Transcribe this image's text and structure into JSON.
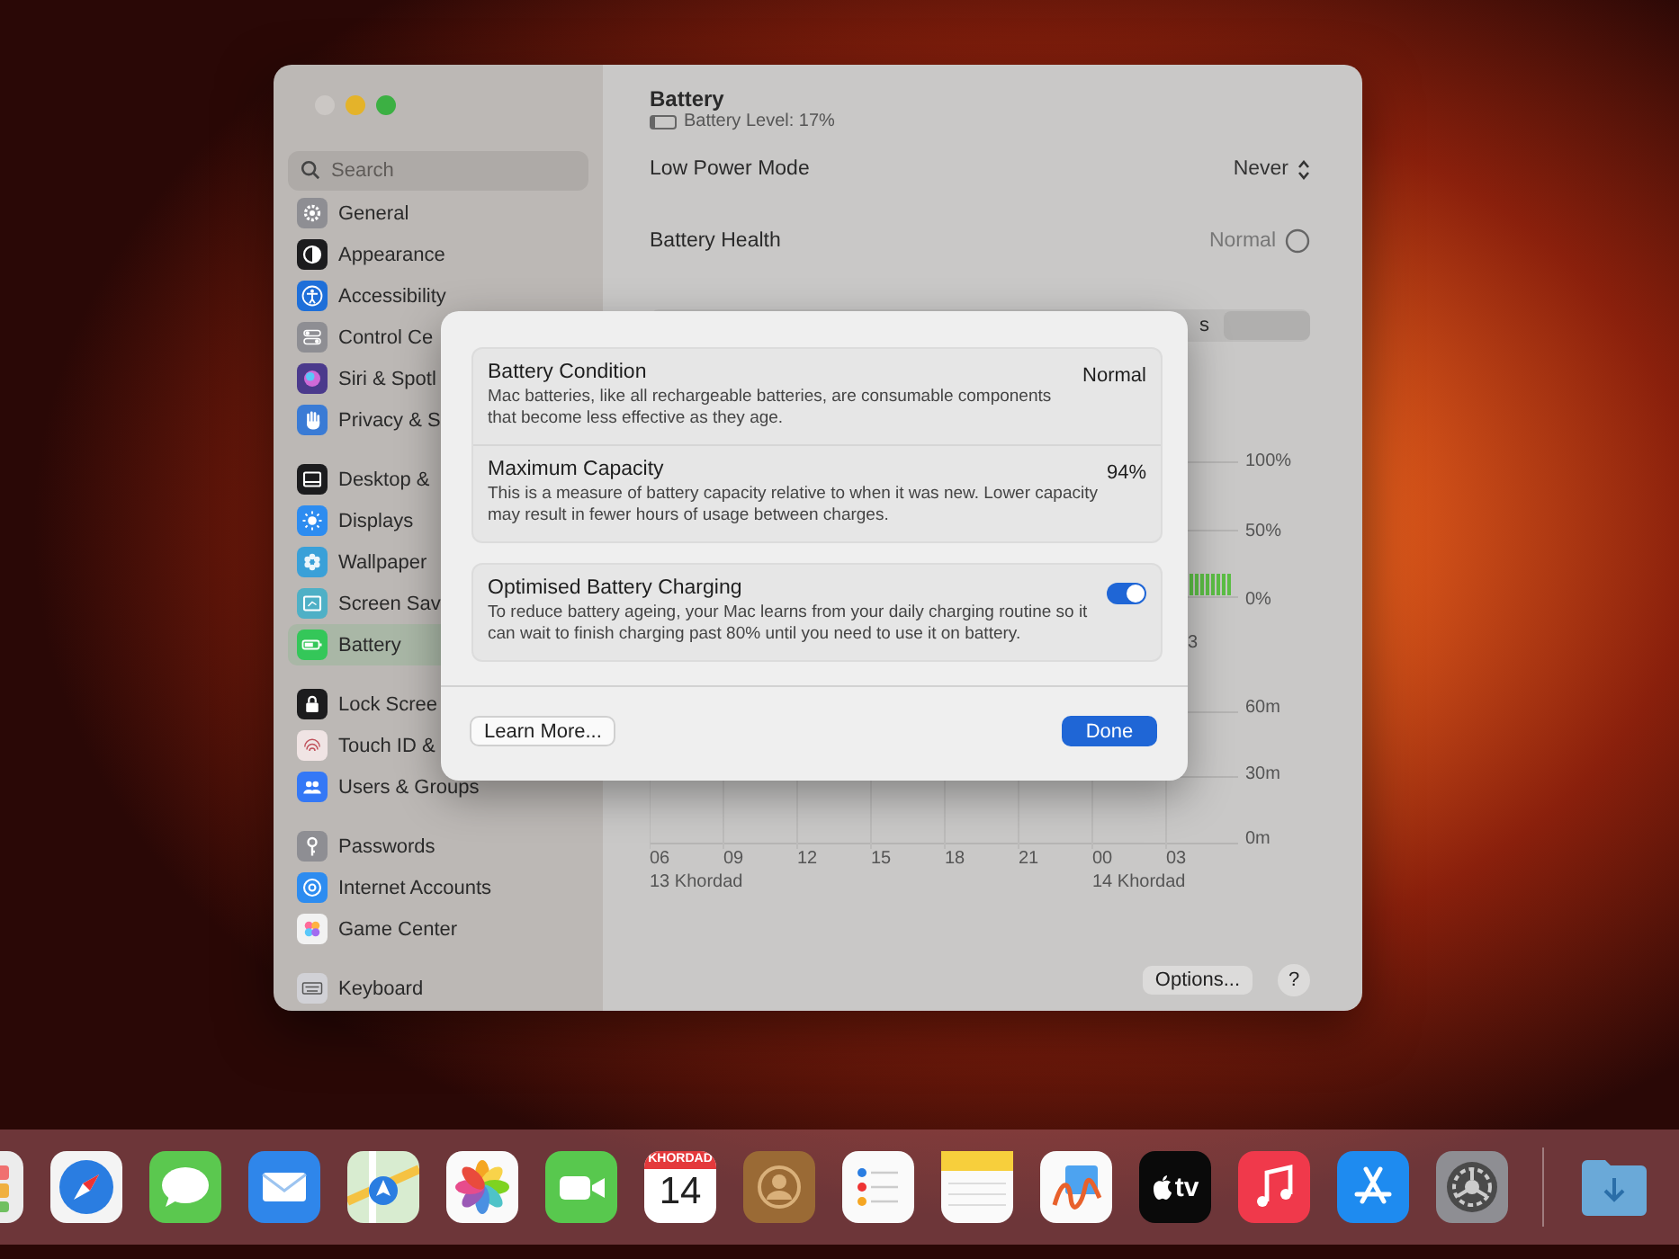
{
  "sidebar": {
    "search": {
      "placeholder": "Search"
    },
    "groups": [
      {
        "items": [
          {
            "label": "General",
            "color": "#8e8e93",
            "selected": false
          },
          {
            "label": "Appearance",
            "color": "#1c1c1e",
            "selected": false
          },
          {
            "label": "Accessibility",
            "color": "#1e6fd9",
            "selected": false
          },
          {
            "label": "Control Ce",
            "color": "#8e8e93",
            "selected": false
          },
          {
            "label": "Siri & Spotl",
            "color": "#4b3a8c",
            "selected": false
          },
          {
            "label": "Privacy & S",
            "color": "#3a7bd5",
            "selected": false
          }
        ]
      },
      {
        "items": [
          {
            "label": "Desktop &",
            "color": "#1c1c1e",
            "selected": false
          },
          {
            "label": "Displays",
            "color": "#2d8cf0",
            "selected": false
          },
          {
            "label": "Wallpaper",
            "color": "#3aa0d8",
            "selected": false
          },
          {
            "label": "Screen Sav",
            "color": "#4fb0c6",
            "selected": false
          },
          {
            "label": "Battery",
            "color": "#34c759",
            "selected": true
          }
        ]
      },
      {
        "items": [
          {
            "label": "Lock Scree",
            "color": "#1c1c1e",
            "selected": false
          },
          {
            "label": "Touch ID &",
            "color": "#f0e4e4",
            "selected": false
          },
          {
            "label": "Users & Groups",
            "color": "#3478f6",
            "selected": false
          }
        ]
      },
      {
        "items": [
          {
            "label": "Passwords",
            "color": "#8e8e93",
            "selected": false
          },
          {
            "label": "Internet Accounts",
            "color": "#2d8cf0",
            "selected": false
          },
          {
            "label": "Game Center",
            "color": "#f2f2f2",
            "selected": false
          }
        ]
      },
      {
        "items": [
          {
            "label": "Keyboard",
            "color": "#d1d1d6",
            "selected": false
          }
        ]
      }
    ]
  },
  "pane": {
    "title": "Battery",
    "battery_level": {
      "label": "Battery Level: 17%",
      "level": 0.17
    },
    "settings": [
      {
        "label": "Low Power Mode",
        "value": "Never",
        "kind": "popup"
      },
      {
        "label": "Battery Health",
        "value": "Normal",
        "kind": "info"
      }
    ],
    "segment_fragment": "s",
    "level_chart": {
      "yticks": [
        "100%",
        "50%",
        "0%"
      ],
      "hour_fragment": "3"
    },
    "usage_chart": {
      "yticks": [
        "60m",
        "30m",
        "0m"
      ],
      "hours": [
        {
          "label": "06",
          "date": "13 Khordad"
        },
        {
          "label": "09"
        },
        {
          "label": "12"
        },
        {
          "label": "15"
        },
        {
          "label": "18"
        },
        {
          "label": "21"
        },
        {
          "label": "00",
          "date": "14 Khordad"
        },
        {
          "label": "03"
        }
      ]
    },
    "options_button": "Options...",
    "help_button": "?"
  },
  "dialog": {
    "cards": [
      {
        "rows": [
          {
            "title": "Battery Condition",
            "description": "Mac batteries, like all rechargeable batteries, are consumable components that become less effective as they age.",
            "value": "Normal",
            "kind": "value"
          },
          {
            "title": "Maximum Capacity",
            "description": "This is a measure of battery capacity relative to when it was new. Lower capacity may result in fewer hours of usage between charges.",
            "value": "94%",
            "kind": "value"
          }
        ]
      },
      {
        "rows": [
          {
            "title": "Optimised Battery Charging",
            "description": "To reduce battery ageing, your Mac learns from your daily charging routine so it can wait to finish charging past 80% until you need to use it on battery.",
            "on": true,
            "kind": "toggle"
          }
        ]
      }
    ],
    "buttons": [
      {
        "label": "Learn More...",
        "kind": "secondary"
      },
      {
        "label": "Done",
        "kind": "primary"
      }
    ]
  },
  "dock": {
    "calendar": {
      "month": "KHORDAD",
      "day": "14"
    },
    "tv_label": "tv"
  }
}
